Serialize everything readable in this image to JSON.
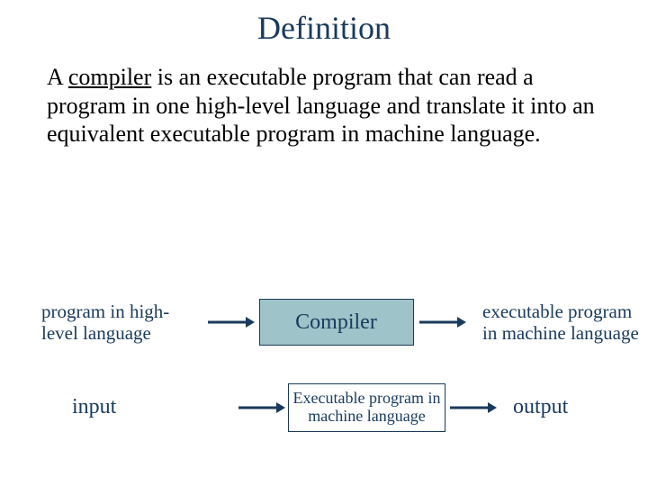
{
  "title": "Definition",
  "paragraph": {
    "lead": "A ",
    "term": "compiler",
    "rest": " is an executable program that can read a program in one high-level language and translate it into an equivalent executable program in machine language."
  },
  "diagram": {
    "row1": {
      "left": "program in high-level language",
      "box": "Compiler",
      "right": "executable program in machine language"
    },
    "row2": {
      "left": "input",
      "box": "Executable program in machine language",
      "right": "output"
    }
  },
  "colors": {
    "text": "#1a3a5c",
    "boxFill": "#9ec3c8"
  }
}
